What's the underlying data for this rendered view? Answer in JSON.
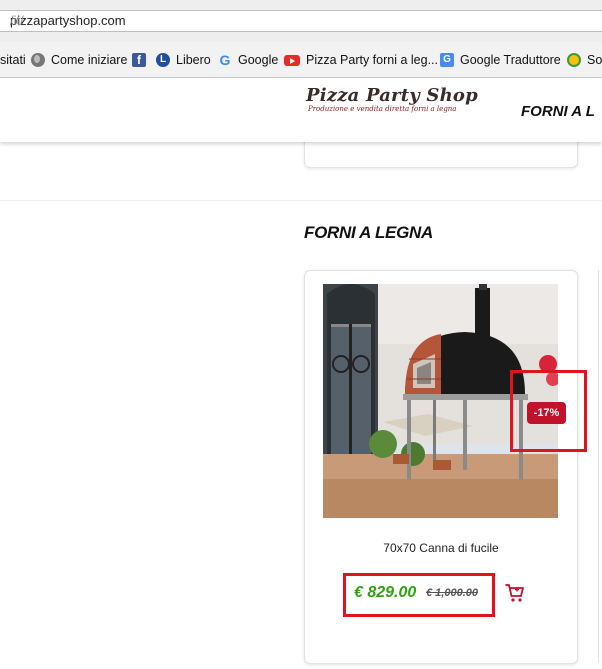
{
  "browser": {
    "url_domain": "pizzapartyshop.com",
    "url_path": "/it/",
    "bookmarks": [
      {
        "label": "sitati",
        "icon": "none"
      },
      {
        "label": "Come iniziare",
        "icon": "globe-icon"
      },
      {
        "label": "",
        "icon": "facebook-icon"
      },
      {
        "label": "Libero",
        "icon": "libero-icon"
      },
      {
        "label": "Google",
        "icon": "google-icon"
      },
      {
        "label": "Pizza Party forni a leg...",
        "icon": "youtube-icon"
      },
      {
        "label": "Google Traduttore",
        "icon": "google-translate-icon"
      },
      {
        "label": "Sol",
        "icon": "sol-icon"
      }
    ]
  },
  "header": {
    "logo_title": "Pizza Party Shop",
    "logo_subtitle": "Produzione e vendita diretta forni a legna",
    "nav_title": "FORNI A L"
  },
  "section": {
    "title": "FORNI A LEGNA"
  },
  "product": {
    "name": "70x70 Canna di fucile",
    "discount": "-17%",
    "price_current": "€ 829.00",
    "price_old": "€ 1,000.00"
  },
  "colors": {
    "price_green": "#2ea30f",
    "badge_red": "#c0122a",
    "highlight_red": "#e0141e",
    "oven_black": "#1a1a1a",
    "oven_brick": "#b5553a"
  }
}
